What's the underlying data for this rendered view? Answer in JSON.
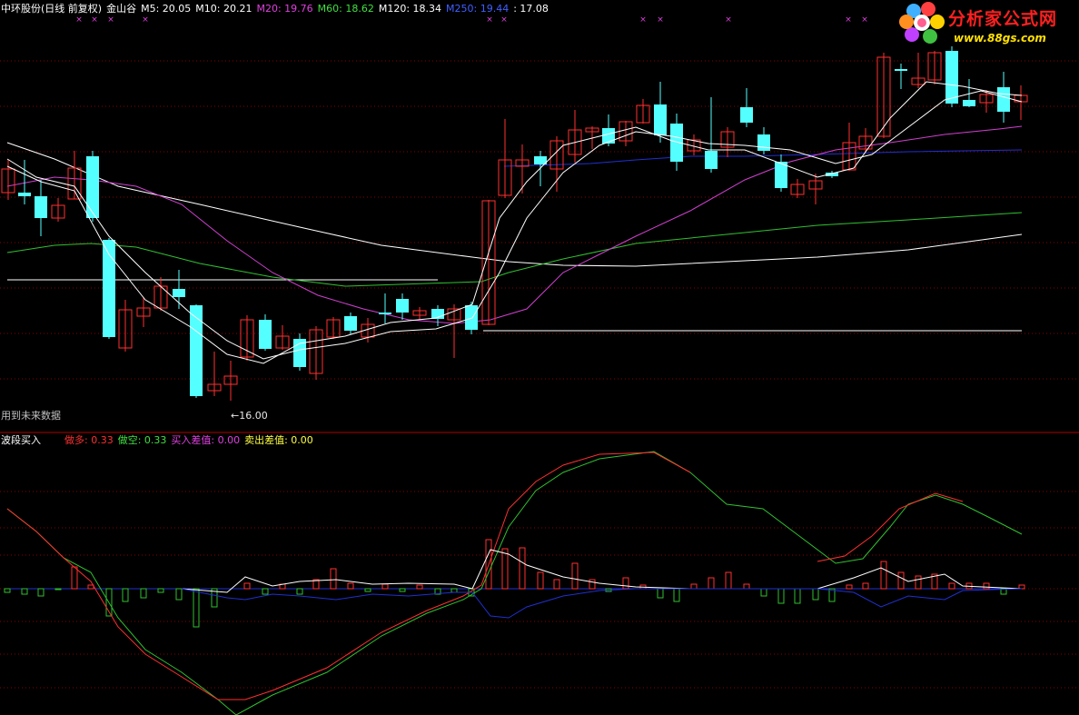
{
  "header": {
    "stock": "中环股份(日线 前复权)",
    "indicator": "金山谷",
    "ma": [
      {
        "label": "M5: 20.05",
        "color": "#ffffff"
      },
      {
        "label": "M10: 20.21",
        "color": "#ffffff"
      },
      {
        "label": "M20: 19.76",
        "color": "#e040e0"
      },
      {
        "label": "M60: 18.62",
        "color": "#40e040"
      },
      {
        "label": "M120: 18.34",
        "color": "#ffffff"
      },
      {
        "label": "M250: 19.44",
        "color": "#4060ff"
      },
      {
        "label": ": 17.08",
        "color": "#ffffff"
      }
    ]
  },
  "main_panel": {
    "future_data_note": "用到未来数据",
    "low_label": "←16.00"
  },
  "sub_panel": {
    "title": "波段买入",
    "items": [
      {
        "label": "做多: 0.33",
        "color": "#ff3030"
      },
      {
        "label": "做空: 0.33",
        "color": "#40e040"
      },
      {
        "label": "买入差值: 0.00",
        "color": "#e040e0"
      },
      {
        "label": "卖出差值: 0.00",
        "color": "#ffff40"
      }
    ]
  },
  "logo": {
    "title": "分析家公式网",
    "url": "www.88gs.com"
  },
  "colors": {
    "background": "#000000",
    "up_candle": "#ff3030",
    "down_candle": "#54ffff",
    "grid": "#8a0000",
    "ma_white": "#ffffff",
    "ma20": "#d040d0",
    "ma60": "#30c030",
    "ma250": "#2030d0"
  },
  "chart_data": {
    "type": "candlestick",
    "low_marker": 16.0,
    "moving_averages": {
      "M5": 20.05,
      "M10": 20.21,
      "M20": 19.76,
      "M60": 18.62,
      "M120": 18.34,
      "M250": 19.44
    },
    "sub_indicator": {
      "name": "波段买入",
      "做多": 0.33,
      "做空": 0.33,
      "买入差值": 0.0,
      "卖出差值": 0.0
    }
  }
}
